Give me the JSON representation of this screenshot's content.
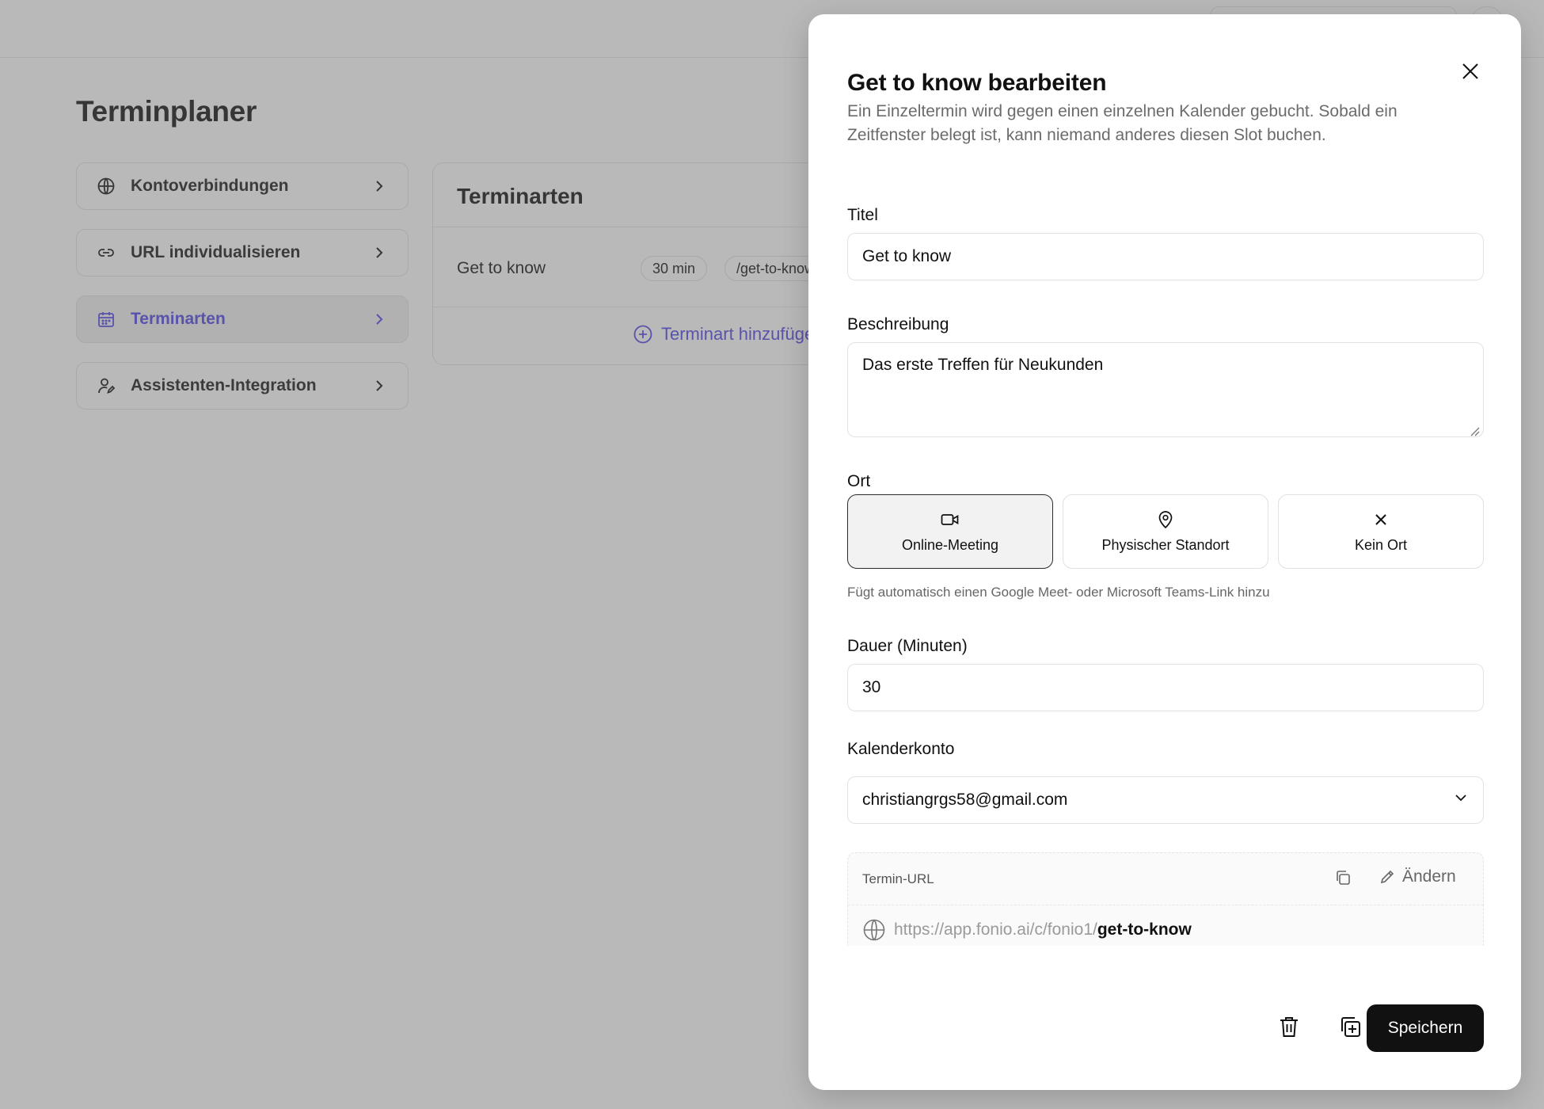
{
  "app": {
    "page_title": "Terminplaner",
    "nav": [
      {
        "label": "Kontoverbindungen",
        "icon": "globe-icon"
      },
      {
        "label": "URL individualisieren",
        "icon": "link-icon"
      },
      {
        "label": "Terminarten",
        "icon": "calendar-icon",
        "active": true
      },
      {
        "label": "Assistenten-Integration",
        "icon": "user-edit-icon"
      }
    ],
    "types_card": {
      "title": "Terminarten",
      "rows": [
        {
          "name": "Get to know",
          "duration": "30 min",
          "slug": "/get-to-know"
        }
      ],
      "add_label": "Terminart hinzufügen"
    }
  },
  "dialog": {
    "title": "Get to know bearbeiten",
    "description": "Ein Einzeltermin wird gegen einen einzelnen Kalender gebucht. Sobald ein Zeitfenster belegt ist, kann niemand anderes diesen Slot buchen.",
    "title_label": "Titel",
    "title_value": "Get to know",
    "description_label": "Beschreibung",
    "description_value": "Das erste Treffen für Neukunden",
    "location_label": "Ort",
    "location_options": [
      {
        "label": "Online-Meeting",
        "icon": "video-camera-icon",
        "selected": true
      },
      {
        "label": "Physischer Standort",
        "icon": "map-pin-icon"
      },
      {
        "label": "Kein Ort",
        "icon": "x-icon"
      }
    ],
    "location_hint": "Fügt automatisch einen Google Meet- oder Microsoft Teams-Link hinzu",
    "duration_label": "Dauer (Minuten)",
    "duration_value": "30",
    "calendar_label": "Kalenderkonto",
    "calendar_value": "christiangrgs58@gmail.com",
    "url": {
      "label": "Termin-URL",
      "edit_label": "Ändern",
      "base": "https://app.fonio.ai/c/fonio1/",
      "slug": "get-to-know"
    },
    "save_label": "Speichern"
  },
  "colors": {
    "accent": "#4f46e5",
    "primary_button": "#111111",
    "overlay": "rgba(100,100,100,0.45)"
  }
}
